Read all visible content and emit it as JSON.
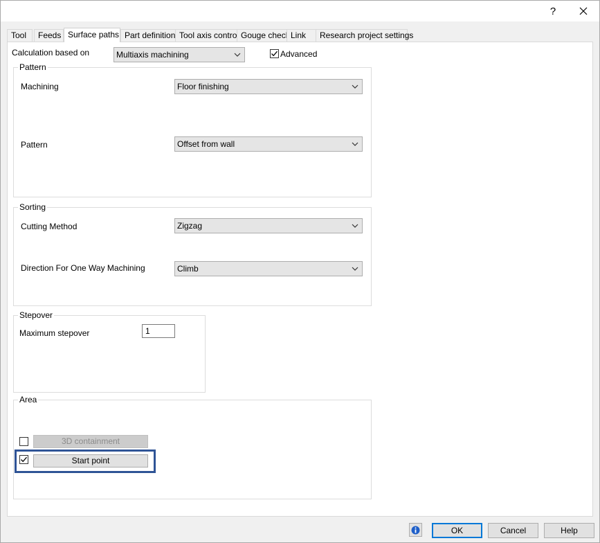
{
  "titlebar": {
    "help_label": "?",
    "close_label": "✕"
  },
  "tabs": [
    {
      "label": "Tool"
    },
    {
      "label": "Feeds"
    },
    {
      "label": "Surface paths"
    },
    {
      "label": "Part definition"
    },
    {
      "label": "Tool axis control"
    },
    {
      "label": "Gouge check"
    },
    {
      "label": "Link"
    },
    {
      "label": "Research project settings"
    }
  ],
  "calculation": {
    "label": "Calculation based on",
    "value": "Multiaxis machining",
    "advanced_label": "Advanced",
    "advanced_checked": true
  },
  "pattern_group": {
    "title": "Pattern",
    "machining_label": "Machining",
    "machining_value": "Floor finishing",
    "pattern_label": "Pattern",
    "pattern_value": "Offset from wall"
  },
  "sorting_group": {
    "title": "Sorting",
    "cutting_label": "Cutting Method",
    "cutting_value": "Zigzag",
    "direction_label": "Direction For One Way Machining",
    "direction_value": "Climb"
  },
  "stepover_group": {
    "title": "Stepover",
    "max_label": "Maximum stepover",
    "max_value": "1"
  },
  "area_group": {
    "title": "Area",
    "containment_label": "3D containment",
    "containment_checked": false,
    "start_point_label": "Start point",
    "start_point_checked": true
  },
  "footer": {
    "ok_label": "OK",
    "cancel_label": "Cancel",
    "help_label": "Help"
  },
  "icons": {
    "dropdown": "chevron-down-icon",
    "check": "check-icon",
    "info": "info-icon"
  }
}
